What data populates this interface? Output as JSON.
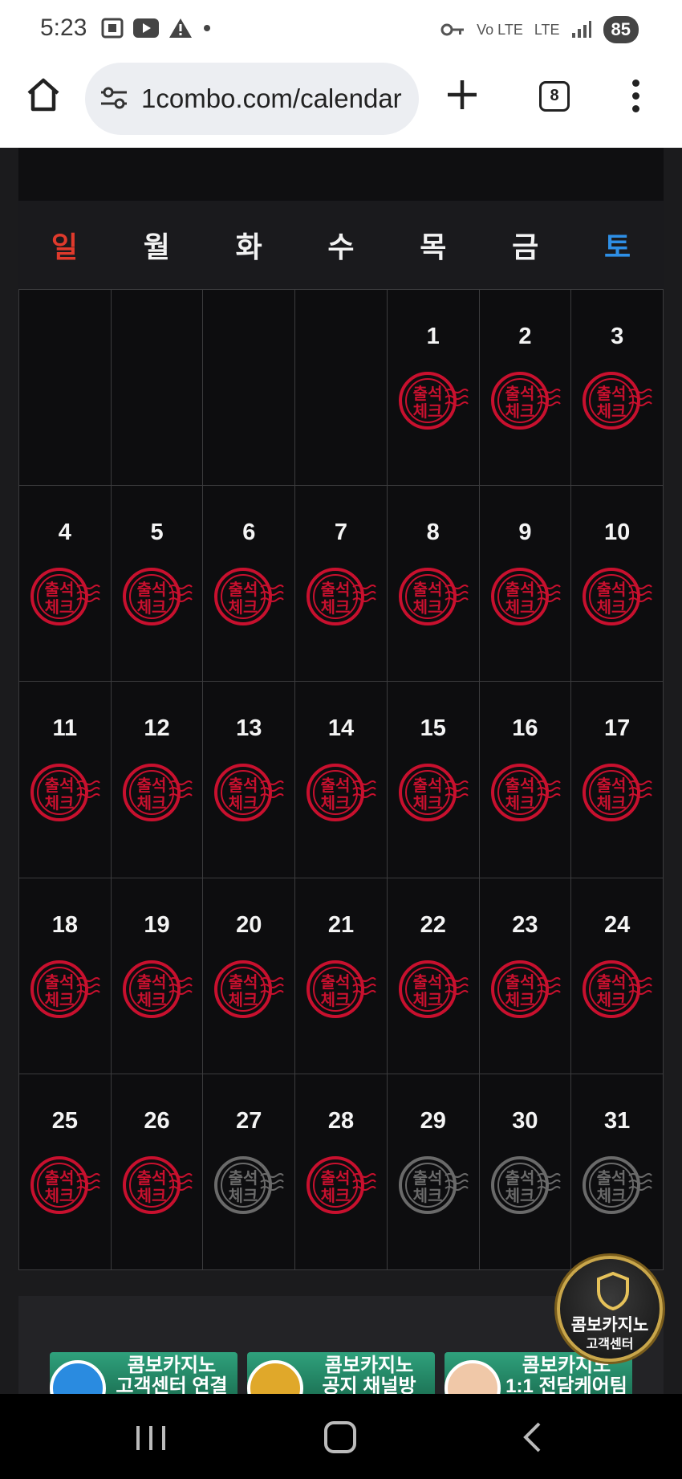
{
  "status_bar": {
    "time": "5:23",
    "network_label": "LTE",
    "volte_label": "Vo LTE",
    "battery": "85"
  },
  "browser": {
    "url": "1combo.com/calendar",
    "tab_count": "8"
  },
  "calendar": {
    "weekdays": [
      {
        "label": "일",
        "color": "#e03a2c"
      },
      {
        "label": "월",
        "color": "#f2f2f2"
      },
      {
        "label": "화",
        "color": "#f2f2f2"
      },
      {
        "label": "수",
        "color": "#f2f2f2"
      },
      {
        "label": "목",
        "color": "#f2f2f2"
      },
      {
        "label": "금",
        "color": "#f2f2f2"
      },
      {
        "label": "토",
        "color": "#2e8fe6"
      }
    ],
    "stamp_text": {
      "line1": "출석",
      "line2": "체크"
    },
    "stamp_colors": {
      "checked": "#c8102e",
      "unchecked": "#6a6a6a"
    },
    "weeks": [
      [
        null,
        null,
        null,
        null,
        {
          "day": "1",
          "checked": true
        },
        {
          "day": "2",
          "checked": true
        },
        {
          "day": "3",
          "checked": true
        }
      ],
      [
        {
          "day": "4",
          "checked": true
        },
        {
          "day": "5",
          "checked": true
        },
        {
          "day": "6",
          "checked": true
        },
        {
          "day": "7",
          "checked": true
        },
        {
          "day": "8",
          "checked": true
        },
        {
          "day": "9",
          "checked": true
        },
        {
          "day": "10",
          "checked": true
        }
      ],
      [
        {
          "day": "11",
          "checked": true
        },
        {
          "day": "12",
          "checked": true
        },
        {
          "day": "13",
          "checked": true
        },
        {
          "day": "14",
          "checked": true
        },
        {
          "day": "15",
          "checked": true
        },
        {
          "day": "16",
          "checked": true
        },
        {
          "day": "17",
          "checked": true
        }
      ],
      [
        {
          "day": "18",
          "checked": true
        },
        {
          "day": "19",
          "checked": true
        },
        {
          "day": "20",
          "checked": true
        },
        {
          "day": "21",
          "checked": true
        },
        {
          "day": "22",
          "checked": true
        },
        {
          "day": "23",
          "checked": true
        },
        {
          "day": "24",
          "checked": true
        }
      ],
      [
        {
          "day": "25",
          "checked": true
        },
        {
          "day": "26",
          "checked": true
        },
        {
          "day": "27",
          "checked": false
        },
        {
          "day": "28",
          "checked": true
        },
        {
          "day": "29",
          "checked": false
        },
        {
          "day": "30",
          "checked": false
        },
        {
          "day": "31",
          "checked": false
        }
      ]
    ]
  },
  "banners": [
    {
      "line1": "콤보카지노",
      "line2": "고객센터 연결"
    },
    {
      "line1": "콤보카지노",
      "line2": "공지 채널방"
    },
    {
      "line1": "콤보카지노",
      "line2": "1:1 전담케어팀"
    }
  ],
  "support_badge": {
    "title": "콤보카지노",
    "subtitle": "고객센터"
  },
  "accent_colors": {
    "stamp_red": "#c8102e",
    "badge_gold": "#c9a64a"
  }
}
